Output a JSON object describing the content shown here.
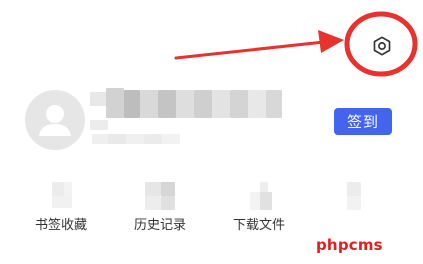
{
  "header": {
    "settings_icon": "settings-hexagon-icon"
  },
  "profile": {
    "avatar_icon": "default-user-avatar-icon",
    "signin_label": "签到"
  },
  "quick_actions": [
    {
      "label": "书签收藏"
    },
    {
      "label": "历史记录"
    },
    {
      "label": "下载文件"
    },
    {
      "label": ""
    }
  ],
  "watermark": {
    "text": "phpcms"
  },
  "annotation": {
    "color": "#e8322e"
  }
}
